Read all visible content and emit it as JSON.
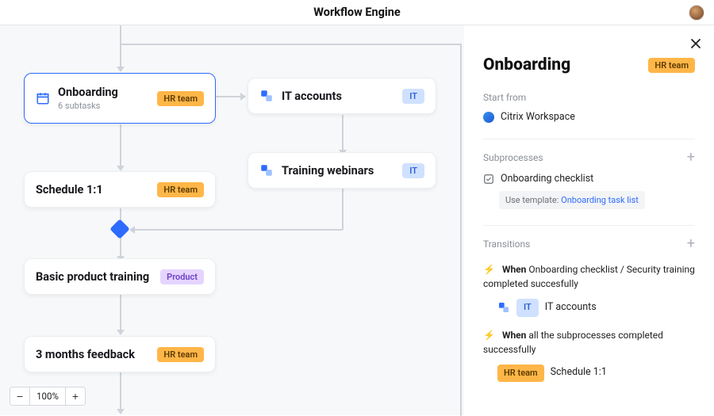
{
  "header": {
    "title": "Workflow Engine"
  },
  "canvas": {
    "nodes": {
      "onboarding": {
        "title": "Onboarding",
        "subtitle": "6 subtasks",
        "tag": "HR team"
      },
      "it_accounts": {
        "title": "IT accounts",
        "tag": "IT"
      },
      "training_webinars": {
        "title": "Training webinars",
        "tag": "IT"
      },
      "schedule_11": {
        "title": "Schedule 1:1",
        "tag": "HR team"
      },
      "basic_training": {
        "title": "Basic product training",
        "tag": "Product"
      },
      "feedback": {
        "title": "3 months feedback",
        "tag": "HR team"
      }
    },
    "zoom": {
      "value": "100%"
    }
  },
  "panel": {
    "title": "Onboarding",
    "tag": "HR team",
    "start_from_label": "Start from",
    "start_from_value": "Citrix Workspace",
    "subprocesses_label": "Subprocesses",
    "subprocess_item": "Onboarding checklist",
    "template_prefix": "Use template:",
    "template_link": "Onboarding task list",
    "transitions_label": "Transitions",
    "transition1": {
      "when": "When",
      "text": "Onboarding checklist / Security training completed succesfully",
      "target_tag": "IT",
      "target": "IT accounts"
    },
    "transition2": {
      "when": "When",
      "text": "all the subprocesses completed successfully",
      "target_tag": "HR team",
      "target": "Schedule 1:1"
    }
  }
}
